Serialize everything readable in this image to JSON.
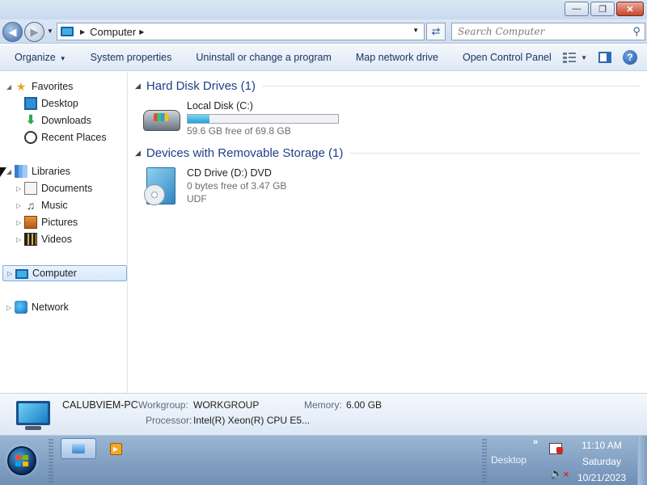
{
  "address_bar": {
    "location": "Computer",
    "search_placeholder": "Search Computer"
  },
  "toolbar": {
    "organize": "Organize",
    "system_properties": "System properties",
    "uninstall": "Uninstall or change a program",
    "map_drive": "Map network drive",
    "control_panel": "Open Control Panel"
  },
  "nav": {
    "favorites": "Favorites",
    "desktop": "Desktop",
    "downloads": "Downloads",
    "recent": "Recent Places",
    "libraries": "Libraries",
    "documents": "Documents",
    "music": "Music",
    "pictures": "Pictures",
    "videos": "Videos",
    "computer": "Computer",
    "network": "Network"
  },
  "content": {
    "hdd_group": "Hard Disk Drives (1)",
    "local_disk": {
      "name": "Local Disk (C:)",
      "free_text": "59.6 GB free of 69.8 GB",
      "used_fraction": 0.146
    },
    "removable_group": "Devices with Removable Storage (1)",
    "cd_drive": {
      "name": "CD Drive (D:) DVD",
      "free_text": "0 bytes free of 3.47 GB",
      "fs": "UDF"
    }
  },
  "details": {
    "pc_name": "CALUBVIEM-PC",
    "workgroup_label": "Workgroup:",
    "workgroup_value": "WORKGROUP",
    "memory_label": "Memory:",
    "memory_value": "6.00 GB",
    "processor_label": "Processor:",
    "processor_value": "Intel(R) Xeon(R) CPU E5..."
  },
  "taskbar": {
    "desktop_label": "Desktop",
    "time": "11:10 AM",
    "day": "Saturday",
    "date": "10/21/2023"
  },
  "colors": {
    "accent": "#1e3f87",
    "bar_fill": "#26a0da"
  }
}
